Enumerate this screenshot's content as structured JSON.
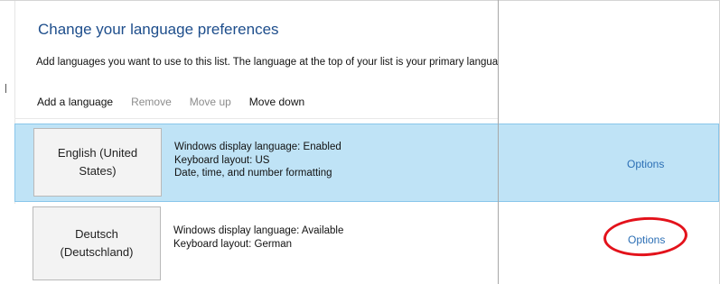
{
  "header": {
    "title": "Change your language preferences",
    "description": "Add languages you want to use to this list. The language at the top of your list is your primary language"
  },
  "toolbar": {
    "add_label": "Add a language",
    "remove_label": "Remove",
    "move_up_label": "Move up",
    "move_down_label": "Move down"
  },
  "languages": [
    {
      "name_line1": "English (United",
      "name_line2": "States)",
      "line1": "Windows display language: Enabled",
      "line2": "Keyboard layout: US",
      "line3": "Date, time, and number formatting",
      "options_label": "Options",
      "selected": true
    },
    {
      "name_line1": "Deutsch",
      "name_line2": "(Deutschland)",
      "line1": "Windows display language: Available",
      "line2": "Keyboard layout: German",
      "options_label": "Options",
      "selected": false
    }
  ],
  "colors": {
    "title": "#1e4e8c",
    "selected_row": "#bfe3f6",
    "link": "#2c6fb5",
    "annotation_circle": "#e3121b"
  }
}
